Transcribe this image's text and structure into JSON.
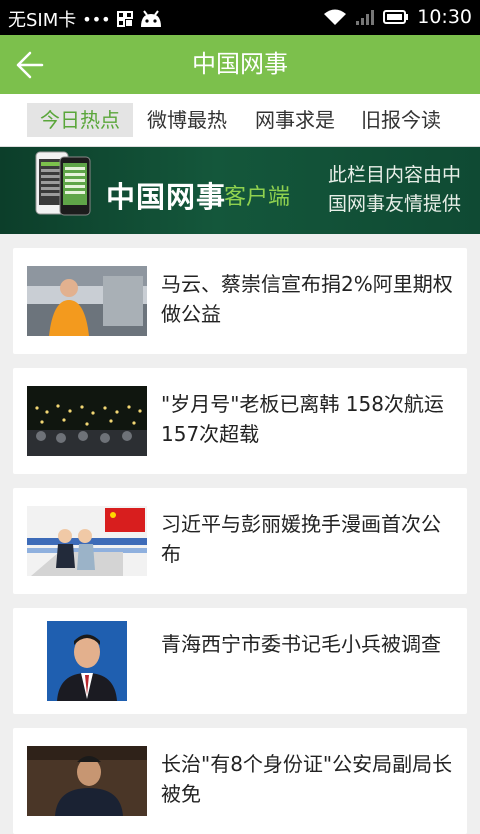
{
  "status_bar": {
    "carrier": "无SIM卡",
    "dots": "•••",
    "time": "10:30",
    "icons": [
      "overflow-dots-icon",
      "grid-app-icon",
      "android-icon",
      "wifi-icon",
      "signal-icon",
      "battery-icon"
    ]
  },
  "app_bar": {
    "back_icon": "back-arrow-icon",
    "title": "中国网事",
    "color": "#7cc04c"
  },
  "tabs": [
    {
      "label": "今日热点",
      "active": true
    },
    {
      "label": "微博最热",
      "active": false
    },
    {
      "label": "网事求是",
      "active": false
    },
    {
      "label": "旧报今读",
      "active": false
    }
  ],
  "banner": {
    "brand": "中国网事",
    "client": "客户端",
    "note_line1": "此栏目内容由中",
    "note_line2": "国网事友情提供"
  },
  "news": [
    {
      "title": "马云、蔡崇信宣布捐2%阿里期权做公益"
    },
    {
      "title": "\"岁月号\"老板已离韩 158次航运157次超载"
    },
    {
      "title": "习近平与彭丽媛挽手漫画首次公布"
    },
    {
      "title": "青海西宁市委书记毛小兵被调查"
    },
    {
      "title": "长治\"有8个身份证\"公安局副局长被免"
    }
  ],
  "colors": {
    "accent": "#7cc04c",
    "active_tab_text": "#5aa63a",
    "banner_bg": "#14573b"
  }
}
